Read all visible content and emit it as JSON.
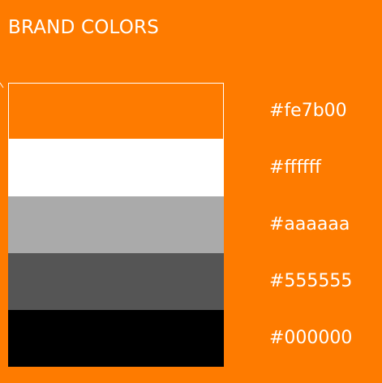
{
  "header": {
    "title": "BRAND COLORS"
  },
  "palette": {
    "swatches": [
      {
        "hex": "#fe7b00",
        "color": "#fe7b00"
      },
      {
        "hex": "#ffffff",
        "color": "#ffffff"
      },
      {
        "hex": "#aaaaaa",
        "color": "#aaaaaa"
      },
      {
        "hex": "#555555",
        "color": "#555555"
      },
      {
        "hex": "#000000",
        "color": "#000000"
      }
    ]
  },
  "colors": {
    "background": "#fe7b00",
    "text": "#ffffff"
  }
}
